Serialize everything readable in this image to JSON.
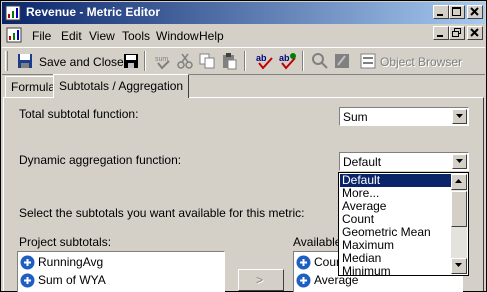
{
  "window": {
    "title": "Revenue - Metric Editor"
  },
  "menu": {
    "items": [
      "File",
      "Edit",
      "View",
      "Tools",
      "Window",
      "Help"
    ]
  },
  "toolbar": {
    "save_close_label": "Save and Close",
    "object_browser_label": "Object Browser"
  },
  "tabs": [
    {
      "label": "Formula",
      "active": false
    },
    {
      "label": "Subtotals / Aggregation",
      "active": true
    }
  ],
  "form": {
    "total_subtotal_label": "Total subtotal function:",
    "total_subtotal_value": "Sum",
    "dynamic_aggregation_label": "Dynamic aggregation function:",
    "dynamic_aggregation_value": "Default",
    "select_subtotals_label": "Select the subtotals you want available for this metric:",
    "project_subtotals_label": "Project subtotals:",
    "available_label": "Available",
    "move_button_label": ">"
  },
  "dropdown": {
    "options": [
      "Default",
      "More...",
      "Average",
      "Count",
      "Geometric Mean",
      "Maximum",
      "Median",
      "Minimum"
    ],
    "selected": "Default"
  },
  "project_subtotals": [
    "RunningAvg",
    "Sum of WYA"
  ],
  "available_subtotals": [
    "Count",
    "Average"
  ],
  "colors": {
    "title_start": "#0a246a",
    "title_end": "#a6caf0",
    "selection": "#0a246a",
    "face": "#d4d0c8"
  }
}
